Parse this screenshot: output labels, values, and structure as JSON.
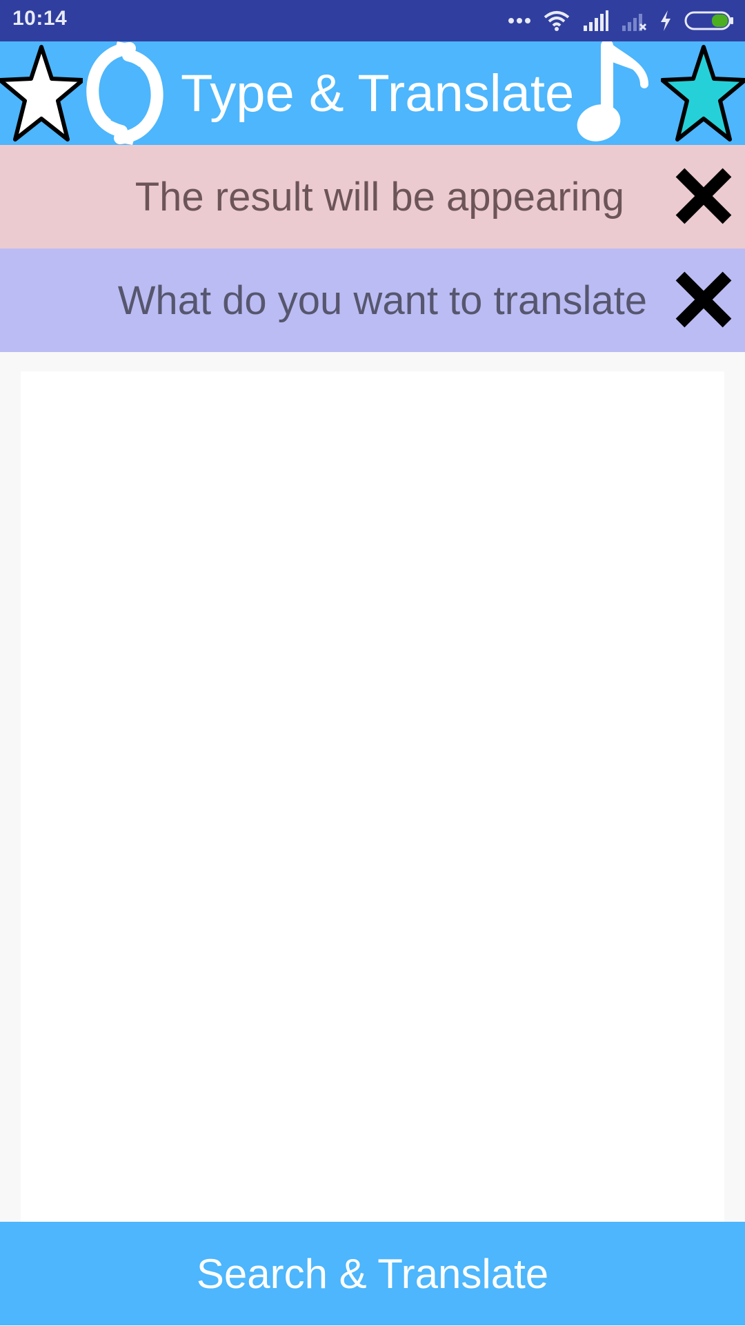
{
  "status_bar": {
    "time": "10:14"
  },
  "app_bar": {
    "title": "Type & Translate",
    "icons": [
      "star-outline-icon",
      "sync-icon",
      "music-note-icon",
      "star-cyan-icon"
    ]
  },
  "result_bar": {
    "text": "The result will be appearing",
    "close_icon": "close-icon"
  },
  "input_bar": {
    "text": "What do you want to translate",
    "close_icon": "close-icon"
  },
  "text_area": {
    "value": "",
    "placeholder": ""
  },
  "bottom_button": {
    "label": "Search & Translate"
  },
  "colors": {
    "status_bar": "#303f9f",
    "primary": "#4db6fc",
    "result_bg": "#eccbd0",
    "input_bg": "#bcbcf4",
    "star_cyan": "#26d0d9"
  }
}
